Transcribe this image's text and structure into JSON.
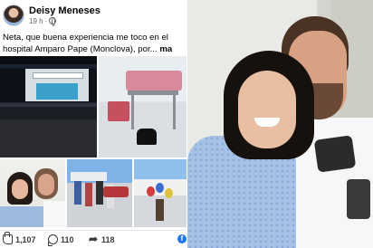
{
  "post": {
    "author": "Deisy Meneses",
    "time": "19 h",
    "separator": "·",
    "text": "Neta, que buena experiencia me toco en el hospital Amparo Pape (Monclova), por...",
    "more": "ma",
    "reactions": {
      "likes": "1,107",
      "comments": "110",
      "shares": "118"
    },
    "icons": {
      "audience": "globe-icon",
      "like": "like-icon",
      "comment": "comment-icon",
      "share": "share-icon",
      "brand": "facebook-icon"
    },
    "colors": {
      "brand": "#1877f2",
      "text": "#050505",
      "muted": "#65676b"
    }
  }
}
